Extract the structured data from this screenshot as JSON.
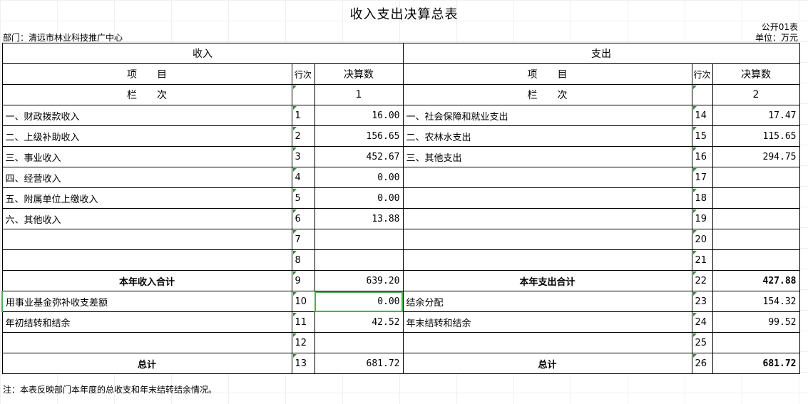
{
  "title": "收入支出决算总表",
  "form_no": "公开01表",
  "department": "部门：清远市林业科技推广中心",
  "unit": "单位：万元",
  "headers": {
    "income": "收入",
    "expense": "支出",
    "item": "项　　目",
    "line": "行次",
    "amount": "决算数",
    "col_label": "栏　　次",
    "col_income": "1",
    "col_expense": "2"
  },
  "rows": [
    {
      "in_item": "一、财政拨款收入",
      "in_no": "1",
      "in_val": "16.00",
      "ex_item": "一、社会保障和就业支出",
      "ex_no": "14",
      "ex_val": "17.47"
    },
    {
      "in_item": "二、上级补助收入",
      "in_no": "2",
      "in_val": "156.65",
      "ex_item": "二、农林水支出",
      "ex_no": "15",
      "ex_val": "115.65"
    },
    {
      "in_item": "三、事业收入",
      "in_no": "3",
      "in_val": "452.67",
      "ex_item": "三、其他支出",
      "ex_no": "16",
      "ex_val": "294.75"
    },
    {
      "in_item": "四、经营收入",
      "in_no": "4",
      "in_val": "0.00",
      "ex_item": "",
      "ex_no": "17",
      "ex_val": ""
    },
    {
      "in_item": "五、附属单位上缴收入",
      "in_no": "5",
      "in_val": "0.00",
      "ex_item": "",
      "ex_no": "18",
      "ex_val": ""
    },
    {
      "in_item": "六、其他收入",
      "in_no": "6",
      "in_val": "13.88",
      "ex_item": "",
      "ex_no": "19",
      "ex_val": ""
    },
    {
      "in_item": "",
      "in_no": "7",
      "in_val": "",
      "ex_item": "",
      "ex_no": "20",
      "ex_val": ""
    },
    {
      "in_item": "",
      "in_no": "8",
      "in_val": "",
      "ex_item": "",
      "ex_no": "21",
      "ex_val": ""
    },
    {
      "in_item": "本年收入合计",
      "in_no": "9",
      "in_val": "639.20",
      "ex_item": "本年支出合计",
      "ex_no": "22",
      "ex_val": "427.88"
    },
    {
      "in_item": "用事业基金弥补收支差额",
      "in_no": "10",
      "in_val": "0.00",
      "ex_item": "结余分配",
      "ex_no": "23",
      "ex_val": "154.32"
    },
    {
      "in_item": "年初结转和结余",
      "in_no": "11",
      "in_val": "42.52",
      "ex_item": "年末结转和结余",
      "ex_no": "24",
      "ex_val": "99.52"
    },
    {
      "in_item": "",
      "in_no": "12",
      "in_val": "",
      "ex_item": "",
      "ex_no": "25",
      "ex_val": ""
    },
    {
      "in_item": "总计",
      "in_no": "13",
      "in_val": "681.72",
      "ex_item": "总计",
      "ex_no": "26",
      "ex_val": "681.72"
    }
  ],
  "note": "注：本表反映部门本年度的总收支和年末结转结余情况。"
}
